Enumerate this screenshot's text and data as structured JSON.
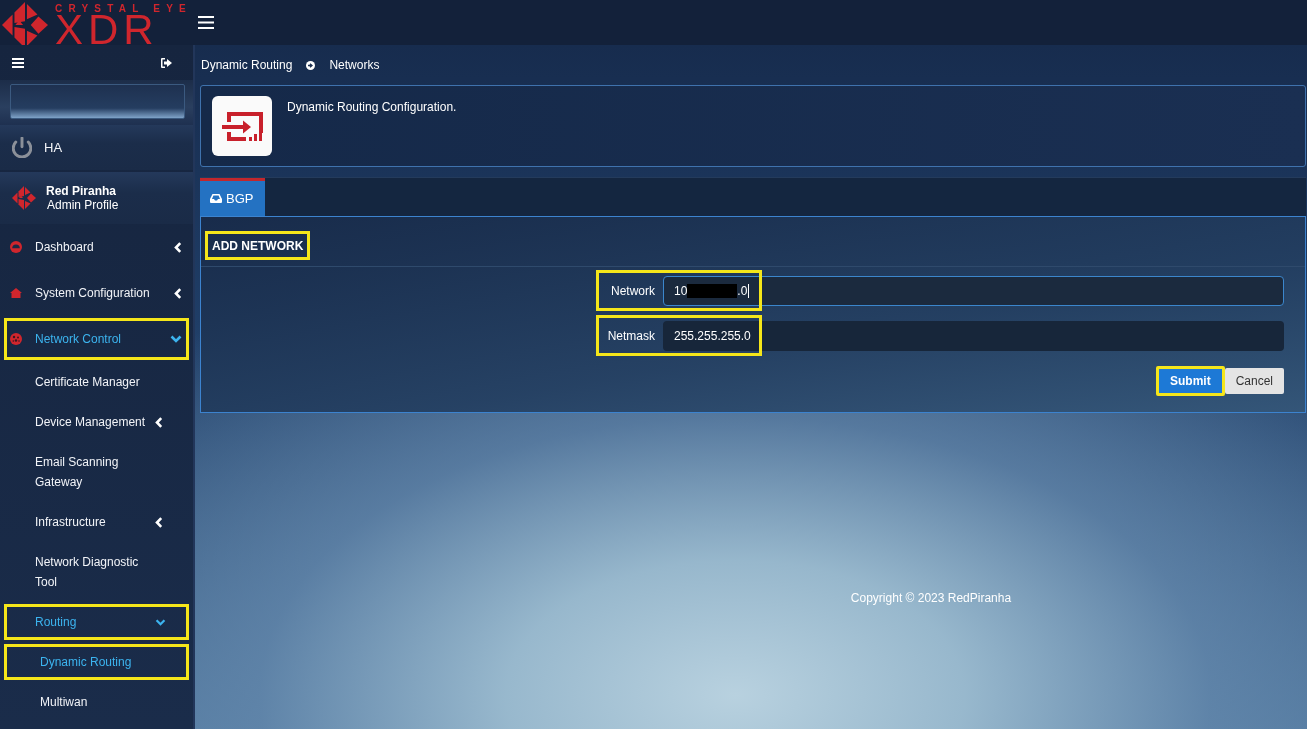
{
  "topbar": {
    "logo": {
      "tagline": "CRYSTAL EYE",
      "wordmark": "XDR"
    }
  },
  "sidebar": {
    "status": {
      "label": "HA"
    },
    "profile": {
      "name": "Red Piranha",
      "role": "Admin Profile"
    },
    "items": [
      {
        "label": "Dashboard",
        "selected": false,
        "expanded": false,
        "highlighted": false
      },
      {
        "label": "System Configuration",
        "selected": false,
        "expanded": false,
        "highlighted": false
      },
      {
        "label": "Network Control",
        "selected": true,
        "expanded": true,
        "highlighted": true,
        "children": [
          {
            "label": "Certificate Manager",
            "selected": false,
            "highlighted": false
          },
          {
            "label": "Device Management",
            "selected": false,
            "expanded": false,
            "highlighted": false
          },
          {
            "label": "Email Scanning Gateway",
            "selected": false,
            "highlighted": false
          },
          {
            "label": "Infrastructure",
            "selected": false,
            "expanded": false,
            "highlighted": false
          },
          {
            "label": "Network Diagnostic Tool",
            "selected": false,
            "highlighted": false
          },
          {
            "label": "Routing",
            "selected": true,
            "expanded": true,
            "highlighted": true,
            "children": [
              {
                "label": "Dynamic Routing",
                "selected": true,
                "highlighted": true
              },
              {
                "label": "Multiwan",
                "selected": false,
                "highlighted": false
              }
            ]
          }
        ]
      }
    ]
  },
  "breadcrumb": [
    "Dynamic Routing",
    "Networks"
  ],
  "header": {
    "description": "Dynamic Routing Configuration."
  },
  "tabs": [
    {
      "label": "BGP",
      "selected": true
    }
  ],
  "panel": {
    "title": "ADD NETWORK",
    "highlighted": true,
    "fields": [
      {
        "label": "Network",
        "value_parts": [
          {
            "kind": "text",
            "text": "10"
          },
          {
            "kind": "redaction"
          },
          {
            "kind": "text",
            "text": ".0"
          }
        ],
        "focused": true,
        "highlighted": true
      },
      {
        "label": "Netmask",
        "value_parts": [
          {
            "kind": "text",
            "text": "255.255.255.0"
          }
        ],
        "focused": false,
        "highlighted": true
      }
    ],
    "buttons": [
      {
        "label": "Submit",
        "kind": "primary",
        "highlighted": true
      },
      {
        "label": "Cancel",
        "kind": "secondary",
        "highlighted": false
      }
    ]
  },
  "footer": {
    "copyright": "Copyright © 2023 RedPiranha"
  }
}
